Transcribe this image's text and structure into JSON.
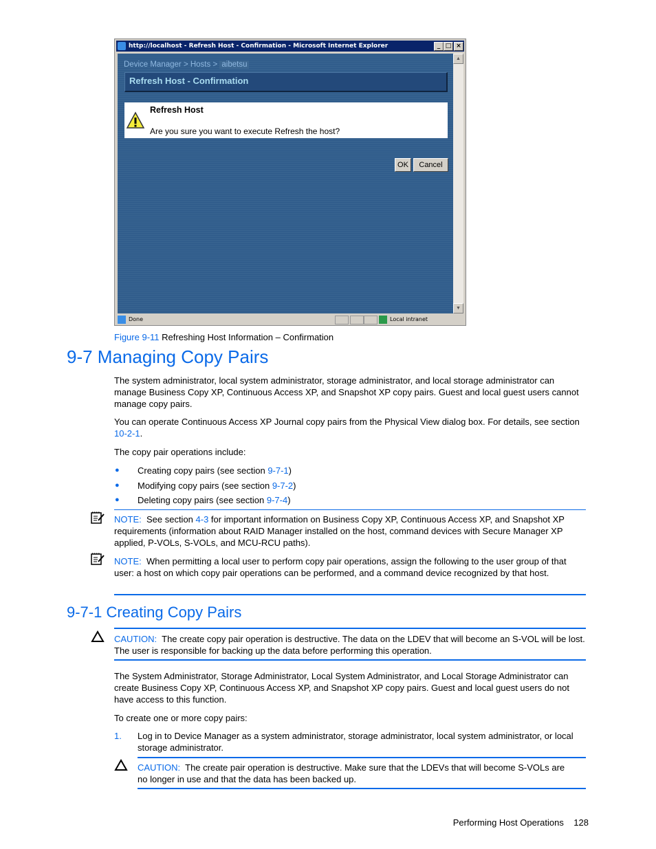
{
  "figure_window": {
    "title": "http://localhost - Refresh Host - Confirmation - Microsoft Internet Explorer",
    "breadcrumb": [
      "Device Manager",
      "Hosts",
      "aibetsu"
    ],
    "breadcrumb_sep": ">",
    "panel_title": "Refresh Host - Confirmation",
    "dialog_heading": "Refresh Host",
    "dialog_message": "Are you sure you want to execute Refresh the host?",
    "ok_label": "OK",
    "cancel_label": "Cancel",
    "status_text": "Done",
    "zone_text": "Local intranet"
  },
  "caption": {
    "label": "Figure 9-11",
    "text": "Refreshing Host Information – Confirmation"
  },
  "section": {
    "title": "9-7 Managing Copy Pairs",
    "para1": "The system administrator, local system administrator, storage administrator, and local storage administrator can manage Business Copy XP, Continuous Access XP, and Snapshot XP copy pairs. Guest and local guest users cannot manage copy pairs.",
    "para2_pre": "You can operate Continuous Access XP Journal copy pairs from the Physical View dialog box. For details, see section ",
    "para2_link": "10-2-1",
    "para2_post": ".",
    "para3": "The copy pair operations include:",
    "bullets": [
      {
        "pre": "Creating copy pairs (see section ",
        "link": "9-7-1",
        "post": ")"
      },
      {
        "pre": "Modifying copy pairs (see section ",
        "link": "9-7-2",
        "post": ")"
      },
      {
        "pre": "Deleting copy pairs (see section ",
        "link": "9-7-4",
        "post": ")"
      }
    ],
    "note1": {
      "label": "NOTE:",
      "pre": "See section ",
      "link": "4-3",
      "post": " for important information on Business Copy XP, Continuous Access XP, and Snapshot XP requirements (information about RAID Manager installed on the host, command devices with Secure Manager XP applied, P-VOLs, S-VOLs, and MCU-RCU paths)."
    },
    "note2": {
      "label": "NOTE:",
      "text": "When permitting a local user to perform copy pair operations, assign the following to the user group of that user: a host on which copy pair operations can be performed, and a command device recognized by that host."
    }
  },
  "subsection": {
    "title": "9-7-1 Creating Copy Pairs",
    "caution1": {
      "label": "CAUTION:",
      "text": "The create copy pair operation is destructive. The data on the LDEV that will become an S-VOL will be lost. The user is responsible for backing up the data before performing this operation."
    },
    "para1": "The System Administrator, Storage Administrator, Local System Administrator, and Local Storage Administrator can create Business Copy XP, Continuous Access XP, and Snapshot XP copy pairs. Guest and local guest users do not have access to this function.",
    "para2": "To create one or more copy pairs:",
    "step1": {
      "num": "1.",
      "text": "Log in to Device Manager as a system administrator, storage administrator, local system administrator, or local storage administrator."
    },
    "caution2": {
      "label": "CAUTION:",
      "text": "The create pair operation is destructive. Make sure that the LDEVs that will become S-VOLs are no longer in use and that the data has been backed up."
    }
  },
  "footer": {
    "chapter": "Performing Host Operations",
    "page": "128"
  },
  "colors": {
    "accent": "#0a6ae8",
    "window_bg": "#2e5a8a",
    "titlebar": "#0a246a"
  }
}
